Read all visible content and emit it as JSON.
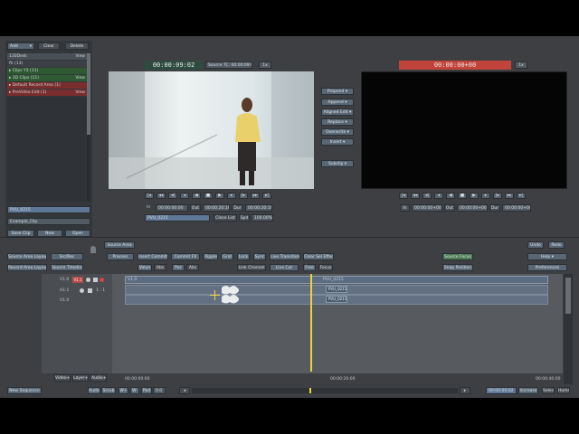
{
  "source": {
    "timecode": "00:00:09:02",
    "tc_label": "Source TC: 00:00:09:02",
    "speed": "1x",
    "in_value": "00:00:00:00",
    "out_value": "00:00:20:16",
    "dur_value": "00:00:20:16",
    "in_label": "In",
    "out_label": "Out",
    "dur_label": "Dur",
    "clip_name": "PVU_0215",
    "close_list": "Close List",
    "spd_label": "Spd",
    "spd_value": "100.00%"
  },
  "record": {
    "timecode": "00:00:00+00",
    "speed": "1x",
    "in_value": "00:00:00+00",
    "out_value": "00:00:00+00",
    "dur_value": "00:00:00+00",
    "in_label": "In",
    "out_label": "Out",
    "dur_label": "Dur"
  },
  "edit_buttons": [
    "Prepend",
    "Append",
    "Aligned Edit",
    "Replace",
    "Overwrite",
    "Insert"
  ],
  "subclip_label": "Subclip",
  "bin": {
    "add_label": "Add",
    "clear_label": "Clear",
    "delete_label": "Delete",
    "title": "130Desk",
    "view_label": "View",
    "root": "fti (13)",
    "items": [
      {
        "label": "Clips Y3 (11)",
        "color": "#3f7a3f",
        "view": ""
      },
      {
        "label": "3D Clips (11)",
        "color": "#3f7a3f",
        "view": "View"
      },
      {
        "label": "Default Record Area (1)",
        "color": "#b03a3a",
        "view": ""
      },
      {
        "label": "PreVideo Edit (1)",
        "color": "#b03a3a",
        "view": "View"
      }
    ],
    "selected_clip": "PVU_0215",
    "example_clip": "Example_Clip",
    "save_clip": "Save Clip",
    "new_label": "New",
    "open_label": "Open"
  },
  "toolbar": {
    "source_area": "Source Area",
    "source_area_layout": "Source Area Layout",
    "src_rec": "Src/Rec",
    "record_area_layout": "Record Area Layout",
    "source_timeline": "Source Timeline",
    "process": "Process",
    "insert_commit": "Insert Commit",
    "commit_fx": "Commit FX",
    "ripple": "Ripple",
    "grid": "Grid",
    "lock": "Lock",
    "sync": "Sync",
    "live_transition": "Live Transition",
    "clear_sel_effect": "Clear Sel Effect",
    "value": "Value",
    "abs": "Abs",
    "pos": "Pos",
    "abs2": "Abs",
    "link_channel": "Link Channel",
    "live_cut": "Live Cut",
    "free": "Free",
    "focus": "Focus",
    "source_focus": "Source Focus",
    "snap_position": "Snap Position",
    "undo": "Undo",
    "redo": "Redo",
    "help": "Help",
    "preferences": "Preferences"
  },
  "tracks": [
    {
      "name": "V1.0",
      "alt": "V1.1"
    },
    {
      "name": "A1:1",
      "alt": "1 : 1"
    },
    {
      "name": "V1.0",
      "alt": ""
    }
  ],
  "timeline": {
    "clip_a": "PVU_0215",
    "clip_b": "PVU_0215",
    "track_header": "V1.0",
    "tc_start": "00:00:00:00",
    "tc_mid": "00:00:20:00",
    "tc_end": "00:00:40:00",
    "video_btn": "Video+",
    "layer_btn": "Layer+",
    "audio_btn": "Audio+"
  },
  "bottom": {
    "new_sequence": "New Sequence",
    "audio": "Audio",
    "scrub": "Scrub",
    "wplus": "W+",
    "wminus": "W-",
    "pad": "Pad",
    "pad_value": "0.0",
    "timecode": "00:00:00:02",
    "increase": "Increase",
    "select": "Select",
    "home": "Home"
  },
  "colors": {
    "accent_red": "#c0443a",
    "accent_green": "#2f4a3f",
    "playhead": "#e8d33a"
  }
}
